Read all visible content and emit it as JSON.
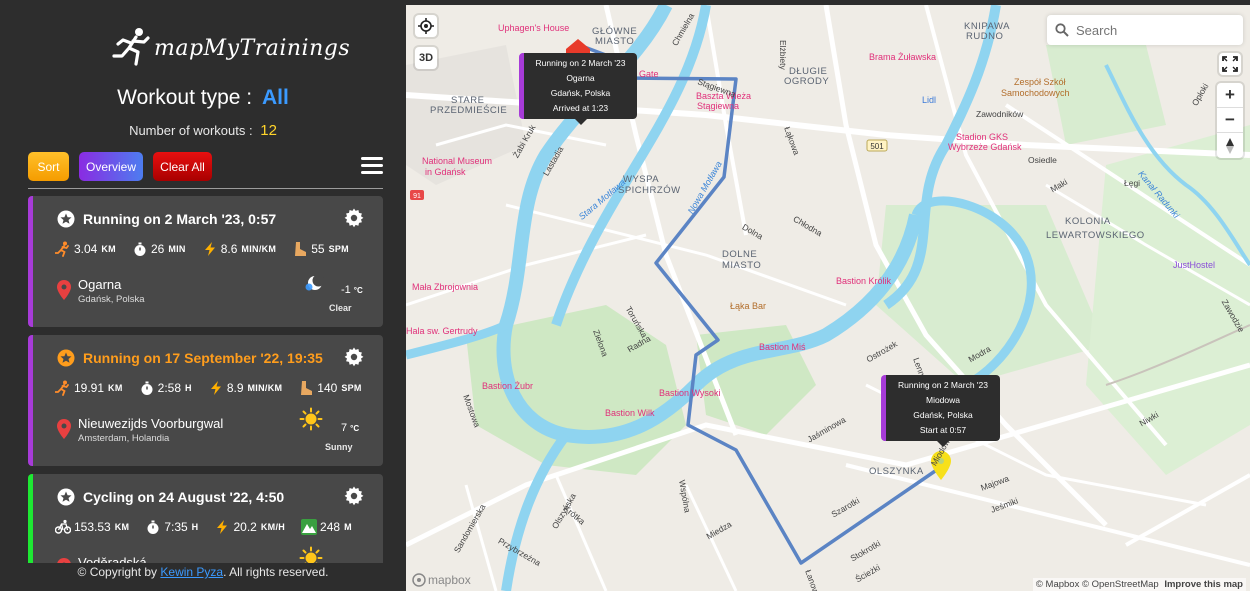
{
  "app": {
    "title": "mapMyTrainings"
  },
  "filter": {
    "workout_type_label": "Workout type :",
    "workout_type_value": "All",
    "count_label": "Number of workouts :",
    "count_value": "12"
  },
  "toolbar": {
    "sort": "Sort",
    "overview": "Overview",
    "clear": "Clear All"
  },
  "workouts": [
    {
      "title": "Running on 2 March '23, 0:57",
      "highlighted": false,
      "accent": "#a73bd8",
      "stats": [
        {
          "icon": "running-icon",
          "value": "3.04",
          "unit": "KM"
        },
        {
          "icon": "stopwatch-icon",
          "value": "26",
          "unit": "MIN"
        },
        {
          "icon": "lightning-icon",
          "value": "8.6",
          "unit": "MIN/KM"
        },
        {
          "icon": "footprint-icon",
          "value": "55",
          "unit": "SPM"
        }
      ],
      "location": "Ogarna",
      "city": "Gdańsk, Polska",
      "weather": {
        "icon": "moon-icon",
        "temp": "-1",
        "unit": "°C",
        "desc": "Clear"
      }
    },
    {
      "title": "Running on 17 September '22, 19:35",
      "highlighted": true,
      "accent": "#a73bd8",
      "stats": [
        {
          "icon": "running-icon",
          "value": "19.91",
          "unit": "KM"
        },
        {
          "icon": "stopwatch-icon",
          "value": "2:58",
          "unit": "H"
        },
        {
          "icon": "lightning-icon",
          "value": "8.9",
          "unit": "MIN/KM"
        },
        {
          "icon": "footprint-icon",
          "value": "140",
          "unit": "SPM"
        }
      ],
      "location": "Nieuwezijds Voorburgwal",
      "city": "Amsterdam, Holandia",
      "weather": {
        "icon": "sun-icon",
        "temp": "7",
        "unit": "°C",
        "desc": "Sunny"
      }
    },
    {
      "title": "Cycling on 24 August '22, 4:50",
      "highlighted": false,
      "accent": "#1ee833",
      "stats": [
        {
          "icon": "bicycle-icon",
          "value": "153.53",
          "unit": "KM"
        },
        {
          "icon": "stopwatch-icon",
          "value": "7:35",
          "unit": "H"
        },
        {
          "icon": "lightning-icon",
          "value": "20.2",
          "unit": "KM/H"
        },
        {
          "icon": "mountain-icon",
          "value": "248",
          "unit": "M"
        }
      ],
      "location": "Voděradská",
      "city": "",
      "weather": {
        "icon": "sun-icon",
        "temp": "",
        "unit": "",
        "desc": ""
      }
    }
  ],
  "footer": {
    "prefix": "© Copyright by",
    "author": "Kewin Pyza",
    "suffix": ". All rights reserved."
  },
  "map": {
    "search_placeholder": "Search",
    "btn_3d": "3D",
    "zoom_in": "+",
    "zoom_out": "−",
    "attribution": "© Mapbox © OpenStreetMap",
    "improve": "Improve this map",
    "logo": "mapbox",
    "popup_end": {
      "line1": "Running on 2 March '23",
      "line2": "Ogarna",
      "line3": "Gdańsk, Polska",
      "line4": "Arrived at 1:23"
    },
    "popup_start": {
      "line1": "Running on 2 March '23",
      "line2": "Miodowa",
      "line3": "Gdańsk, Polska",
      "line4": "Start at 0:57"
    },
    "labels": [
      {
        "t": "GŁÓWNE",
        "c": "dark"
      },
      {
        "t": "MIASTO",
        "c": "dark"
      },
      {
        "t": "Uphagen's House",
        "c": "pink"
      },
      {
        "t": "Gate",
        "c": "pink"
      },
      {
        "t": "STARE",
        "c": "dark"
      },
      {
        "t": "PRZEDMIEŚCIE",
        "c": "dark"
      },
      {
        "t": "DŁUGIE",
        "c": "dark"
      },
      {
        "t": "OGRODY",
        "c": "dark"
      },
      {
        "t": "Baszta Wieża",
        "c": "pink"
      },
      {
        "t": "Stągiewna",
        "c": "pink"
      },
      {
        "t": "Brama Żuławska",
        "c": "pink"
      },
      {
        "t": "KNIPAWA",
        "c": "dark"
      },
      {
        "t": "RUDNO",
        "c": "dark"
      },
      {
        "t": "Zespół Szkół",
        "c": "brown"
      },
      {
        "t": "Samochodowych",
        "c": "brown"
      },
      {
        "t": "Lidl",
        "c": "blue"
      },
      {
        "t": "Stadion GKS",
        "c": "pink"
      },
      {
        "t": "Wybrzeże Gdańsk",
        "c": "pink"
      },
      {
        "t": "National Museum",
        "c": "pink"
      },
      {
        "t": "in Gdańsk",
        "c": "pink"
      },
      {
        "t": "WYSPA",
        "c": "dark"
      },
      {
        "t": "SPICHRZÓW",
        "c": "dark"
      },
      {
        "t": "DOLNE",
        "c": "dark"
      },
      {
        "t": "MIASTO",
        "c": "dark"
      },
      {
        "t": "Łąka Bar",
        "c": "brown"
      },
      {
        "t": "Bastion Królik",
        "c": "pink"
      },
      {
        "t": "KOLONIA",
        "c": "dark"
      },
      {
        "t": "LEWARTOWSKIEGO",
        "c": "dark"
      },
      {
        "t": "JustHostel",
        "c": "purple"
      },
      {
        "t": "Mała Zbrojownia",
        "c": "pink"
      },
      {
        "t": "Bastion Miś",
        "c": "pink"
      },
      {
        "t": "Bastion Żubr",
        "c": "pink"
      },
      {
        "t": "Bastion Wilk",
        "c": "pink"
      },
      {
        "t": "Bastion Wysoki",
        "c": "pink"
      },
      {
        "t": "OLSZYNKA",
        "c": "dark"
      },
      {
        "t": "Hala sw. Gertrudy",
        "c": "pink"
      },
      {
        "t": "Toruńska",
        "c": "road"
      },
      {
        "t": "Zielona",
        "c": "road"
      },
      {
        "t": "Radna",
        "c": "road"
      },
      {
        "t": "Dolna",
        "c": "road"
      },
      {
        "t": "Chłodna",
        "c": "road"
      },
      {
        "t": "Osiedle",
        "c": "road"
      },
      {
        "t": "Maki",
        "c": "road"
      },
      {
        "t": "Łęgi",
        "c": "road"
      },
      {
        "t": "Zawodników",
        "c": "road"
      },
      {
        "t": "Mostowa",
        "c": "road"
      },
      {
        "t": "Jaśminowa",
        "c": "road"
      },
      {
        "t": "Majowa",
        "c": "road"
      },
      {
        "t": "Jeśmiki",
        "c": "road"
      },
      {
        "t": "Szarotki",
        "c": "road"
      },
      {
        "t": "Stokrotki",
        "c": "road"
      },
      {
        "t": "Ścieżki",
        "c": "road"
      },
      {
        "t": "Miedza",
        "c": "road"
      },
      {
        "t": "Wspólna",
        "c": "road"
      },
      {
        "t": "Olszyńska",
        "c": "road"
      },
      {
        "t": "Krótka",
        "c": "road"
      },
      {
        "t": "Przybrzeżna",
        "c": "road"
      },
      {
        "t": "Sandomierska",
        "c": "road"
      },
      {
        "t": "Niwki",
        "c": "road"
      },
      {
        "t": "Modra",
        "c": "road"
      },
      {
        "t": "Ostrożek",
        "c": "road"
      },
      {
        "t": "Lenna",
        "c": "road"
      },
      {
        "t": "Łanowa",
        "c": "road"
      },
      {
        "t": "Żabi Kruk",
        "c": "road"
      },
      {
        "t": "Łąkowa",
        "c": "road"
      },
      {
        "t": "Elżbiety",
        "c": "road"
      },
      {
        "t": "Chmielna",
        "c": "road"
      },
      {
        "t": "Stągiewna",
        "c": "road"
      },
      {
        "t": "Lastadia",
        "c": "road"
      },
      {
        "t": "Stara Motława",
        "c": "river"
      },
      {
        "t": "Nowa Motława",
        "c": "river"
      },
      {
        "t": "Kanał Radunki",
        "c": "river"
      },
      {
        "t": "Opłoki",
        "c": "road"
      },
      {
        "t": "Zawodzie",
        "c": "road"
      },
      {
        "t": "Miodowa",
        "c": "road"
      }
    ],
    "road_badges": [
      "501",
      "91"
    ]
  }
}
